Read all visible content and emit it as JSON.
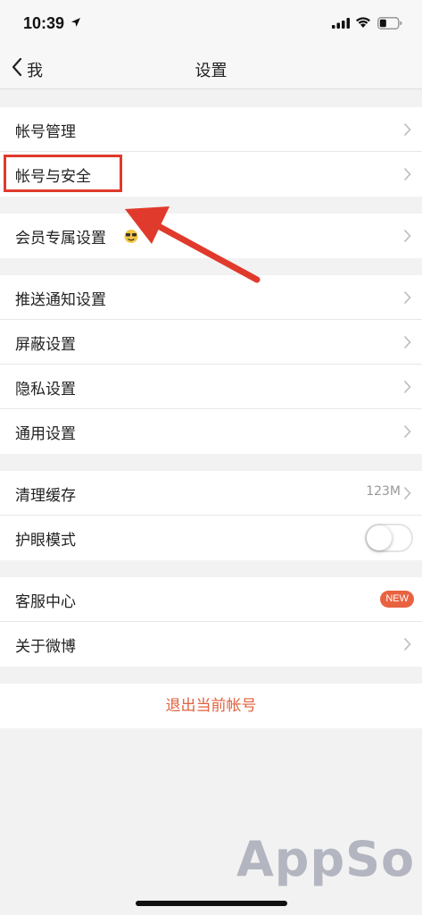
{
  "status_bar": {
    "time": "10:39"
  },
  "nav": {
    "back_label": "我",
    "title": "设置"
  },
  "groups": [
    {
      "items": [
        {
          "label": "帐号管理"
        },
        {
          "label": "帐号与安全"
        }
      ]
    },
    {
      "items": [
        {
          "label": "会员专属设置"
        }
      ]
    },
    {
      "items": [
        {
          "label": "推送通知设置"
        },
        {
          "label": "屏蔽设置"
        },
        {
          "label": "隐私设置"
        },
        {
          "label": "通用设置"
        }
      ]
    },
    {
      "items": [
        {
          "label": "清理缓存",
          "value": "123M"
        },
        {
          "label": "护眼模式",
          "toggle": false
        }
      ]
    },
    {
      "items": [
        {
          "label": "客服中心",
          "badge": "NEW"
        },
        {
          "label": "关于微博"
        }
      ]
    }
  ],
  "logout": {
    "label": "退出当前帐号"
  },
  "watermark": "AppSo",
  "colors": {
    "accent": "#e0623e",
    "highlight": "#e03a2c",
    "badge": "#e8623f"
  }
}
